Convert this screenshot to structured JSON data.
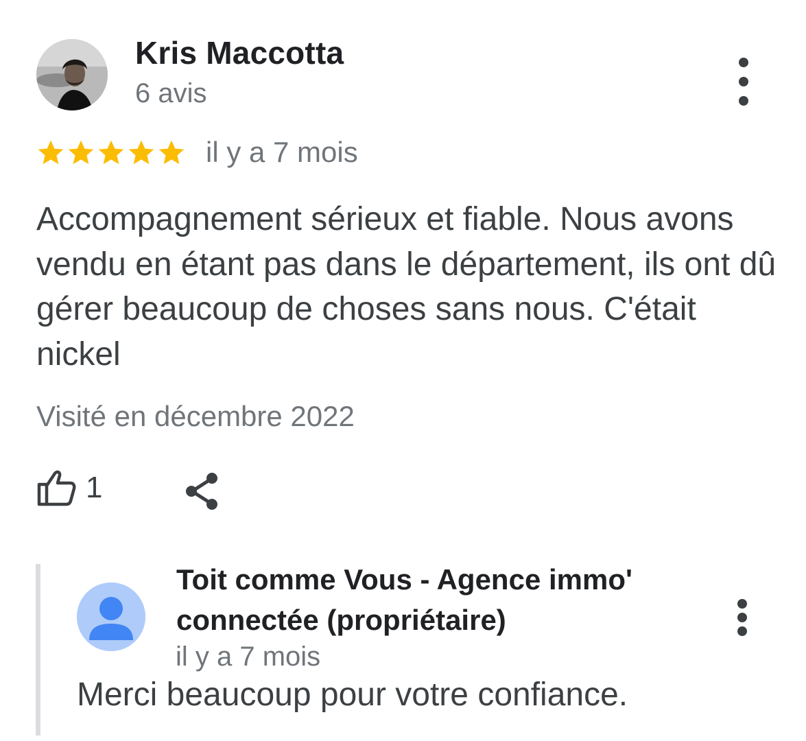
{
  "review": {
    "reviewer_name": "Kris Maccotta",
    "review_count": "6 avis",
    "rating": 5,
    "rating_max": 5,
    "star_color": "#fbbc04",
    "relative_date": "il y a 7 mois",
    "text": "Accompagnement sérieux et fiable. Nous avons vendu en étant pas dans le département, ils ont dû gérer beaucoup de choses sans nous. C'était nickel",
    "visited": "Visité en décembre 2022",
    "like_count": "1",
    "icons": {
      "more": "more-vert-icon",
      "like": "thumb-up-icon",
      "share": "share-icon"
    }
  },
  "owner_reply": {
    "name": "Toit comme Vous - Agence immo' connectée (propriétaire)",
    "relative_date": "il y a 7 mois",
    "text": "Merci beaucoup pour votre confiance.",
    "avatar_color": "#aecbfa",
    "avatar_figure_color": "#4285f4"
  }
}
